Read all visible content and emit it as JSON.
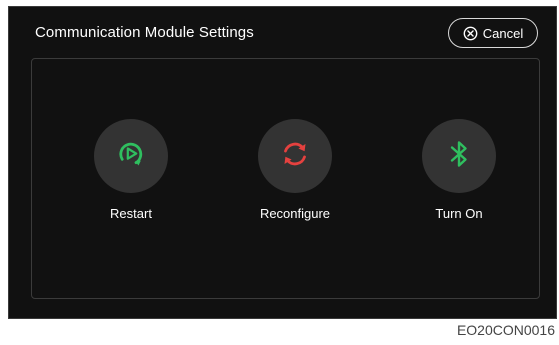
{
  "header": {
    "title": "Communication Module Settings",
    "cancel_label": "Cancel"
  },
  "actions": [
    {
      "label": "Restart",
      "icon": "restart-icon",
      "color": "#2fbf5f"
    },
    {
      "label": "Reconfigure",
      "icon": "reconfigure-icon",
      "color": "#e5413f"
    },
    {
      "label": "Turn On",
      "icon": "bluetooth-icon",
      "color": "#2fbf5f"
    }
  ],
  "footer": {
    "code": "EO20CON0016"
  }
}
